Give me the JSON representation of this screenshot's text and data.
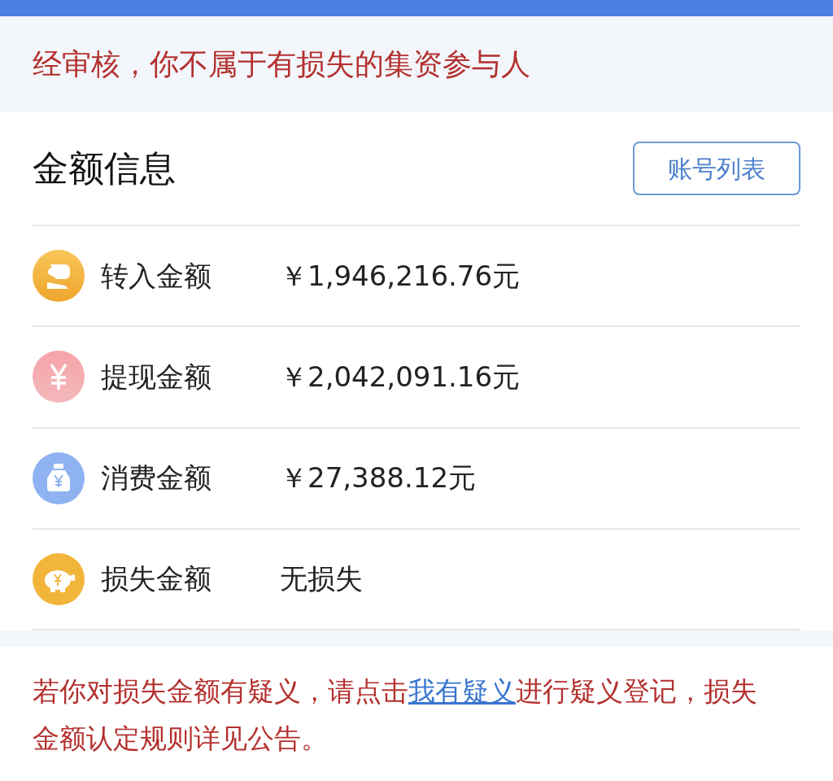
{
  "notice": "经审核，你不属于有损失的集资参与人",
  "section": {
    "title": "金额信息",
    "button": "账号列表"
  },
  "rows": [
    {
      "kind": "transfer-in",
      "label": "转入金额",
      "value": "￥1,946,216.76元"
    },
    {
      "kind": "withdraw",
      "label": "提现金额",
      "value": "￥2,042,091.16元"
    },
    {
      "kind": "spend",
      "label": "消费金额",
      "value": "￥27,388.12元"
    },
    {
      "kind": "loss",
      "label": "损失金额",
      "value": "无损失"
    }
  ],
  "footer": {
    "before": "若你对损失金额有疑义，请点击",
    "link": "我有疑义",
    "after": "进行疑义登记，损失金额认定规则详见公告。"
  }
}
